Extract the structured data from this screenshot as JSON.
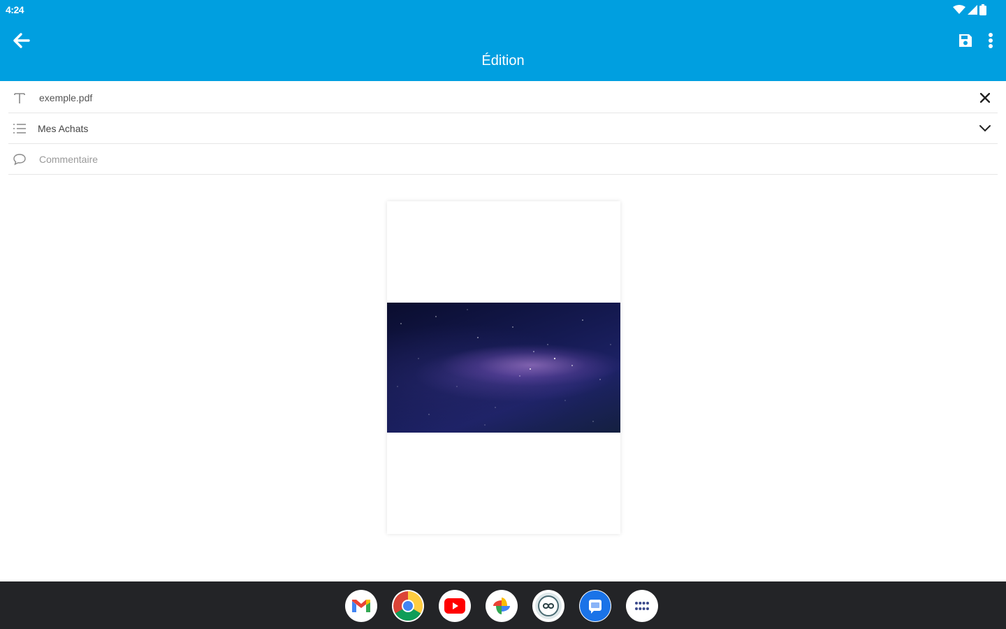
{
  "status_bar": {
    "time": "4:24"
  },
  "header": {
    "title": "Édition"
  },
  "form": {
    "filename_value": "exemple.pdf",
    "category_value": "Mes Achats",
    "comment_placeholder": "Commentaire"
  },
  "taskbar": {
    "apps": [
      "gmail-icon",
      "chrome-icon",
      "youtube-icon",
      "photos-icon",
      "app-icon",
      "messages-icon",
      "app-drawer-icon"
    ]
  },
  "colors": {
    "accent": "#009fe0",
    "taskbar": "#232427"
  }
}
